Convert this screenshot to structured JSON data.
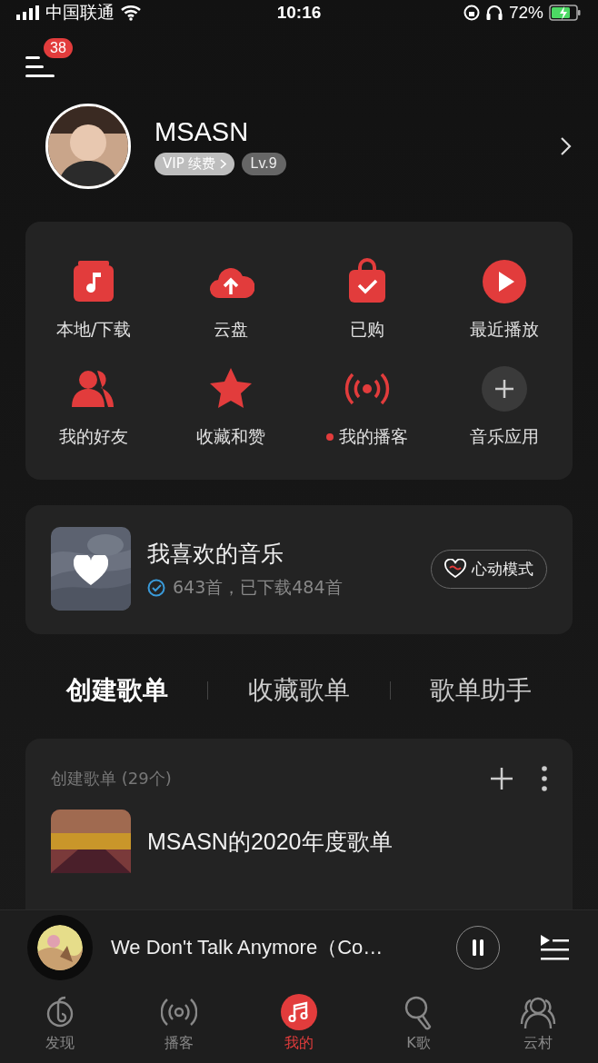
{
  "status_bar": {
    "carrier": "中国联通",
    "time": "10:16",
    "battery": "72%"
  },
  "menu": {
    "badge": "38"
  },
  "profile": {
    "name": "MSASN",
    "vip": "VIP 续费",
    "level": "Lv.9"
  },
  "shortcuts": [
    {
      "label": "本地/下载",
      "kind": "local",
      "new_dot": false
    },
    {
      "label": "云盘",
      "kind": "cloud",
      "new_dot": false
    },
    {
      "label": "已购",
      "kind": "bought",
      "new_dot": false
    },
    {
      "label": "最近播放",
      "kind": "recent",
      "new_dot": false
    },
    {
      "label": "我的好友",
      "kind": "friends",
      "new_dot": false
    },
    {
      "label": "收藏和赞",
      "kind": "favorite",
      "new_dot": false
    },
    {
      "label": "我的播客",
      "kind": "podcast",
      "new_dot": true
    },
    {
      "label": "音乐应用",
      "kind": "add",
      "new_dot": false
    }
  ],
  "liked": {
    "title": "我喜欢的音乐",
    "stats": "643首，已下载484首",
    "button": "心动模式"
  },
  "tabs": [
    {
      "label": "创建歌单",
      "selected": true
    },
    {
      "label": "收藏歌单",
      "selected": false
    },
    {
      "label": "歌单助手",
      "selected": false
    }
  ],
  "playlists": {
    "header": "创建歌单 (29个)",
    "items": [
      {
        "title": "MSASN的2020年度歌单"
      }
    ]
  },
  "player": {
    "title": "We Don't Talk Anymore（Co…",
    "playing": true
  },
  "nav": [
    {
      "label": "发现",
      "kind": "discover",
      "selected": false
    },
    {
      "label": "播客",
      "kind": "podcast",
      "selected": false
    },
    {
      "label": "我的",
      "kind": "mine",
      "selected": true
    },
    {
      "label": "K歌",
      "kind": "karaoke",
      "selected": false
    },
    {
      "label": "云村",
      "kind": "village",
      "selected": false
    }
  ]
}
